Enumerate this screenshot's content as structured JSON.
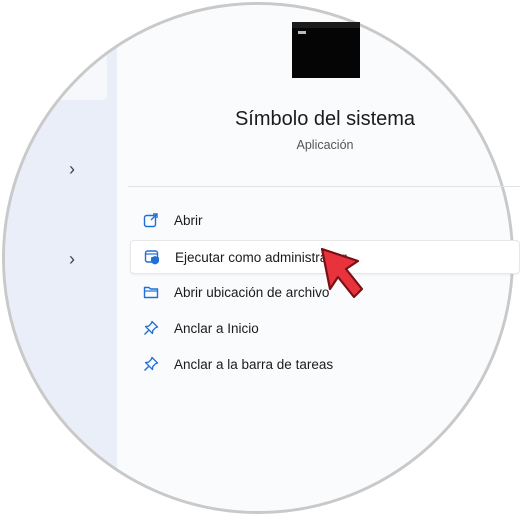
{
  "app": {
    "title": "Símbolo del sistema",
    "subtitle": "Aplicación"
  },
  "menu": {
    "items": [
      {
        "label": "Abrir",
        "icon": "open-external-icon"
      },
      {
        "label": "Ejecutar como administrador",
        "icon": "run-as-admin-icon"
      },
      {
        "label": "Abrir ubicación de archivo",
        "icon": "folder-icon"
      },
      {
        "label": "Anclar a Inicio",
        "icon": "pin-icon"
      },
      {
        "label": "Anclar a la barra de tareas",
        "icon": "pin-icon"
      }
    ],
    "highlighted_index": 1
  },
  "colors": {
    "accent": "#1f6fd6",
    "cursor": "#e8323c"
  }
}
